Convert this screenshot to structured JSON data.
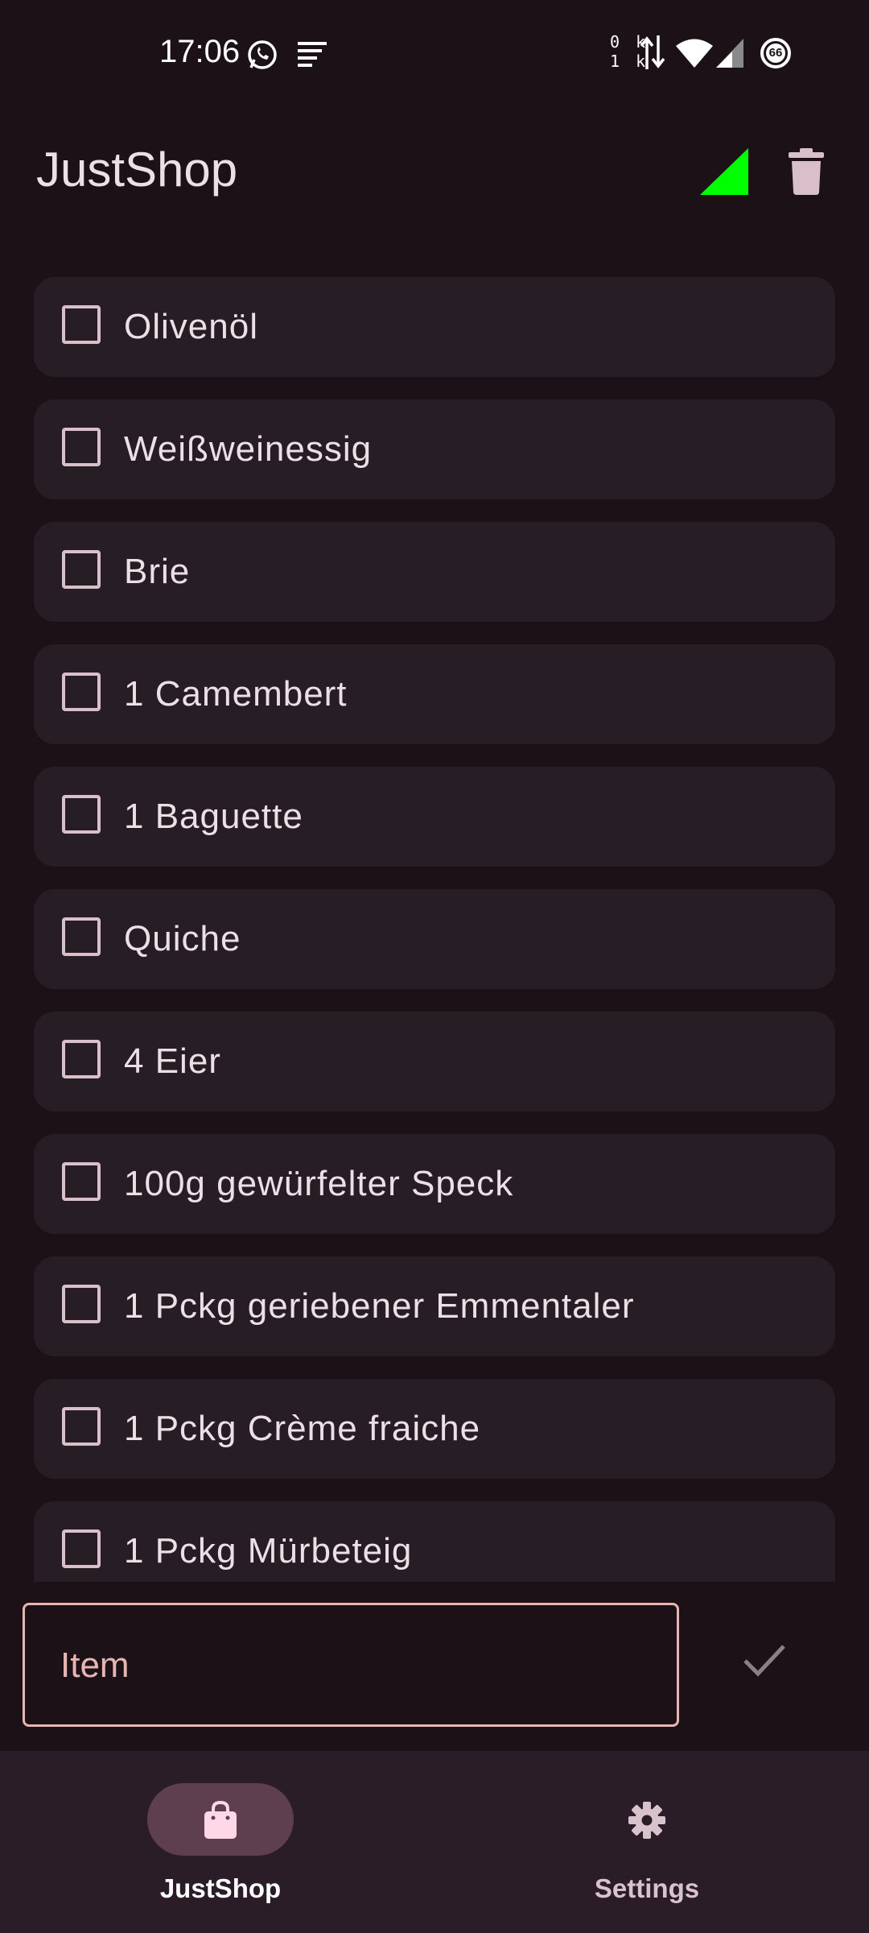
{
  "status_bar": {
    "time": "17:06",
    "net_up": "0 k",
    "net_down": "1 k",
    "battery": "66",
    "icons": [
      "whatsapp-icon",
      "notification-lines-icon",
      "data-arrows-icon",
      "wifi-icon",
      "cell-signal-icon",
      "battery-icon"
    ]
  },
  "app_bar": {
    "title": "JustShop",
    "actions": [
      "signal-triangle-icon",
      "trash-icon"
    ]
  },
  "list": {
    "items": [
      {
        "label": "Olivenöl",
        "checked": false
      },
      {
        "label": "Weißweinessig",
        "checked": false
      },
      {
        "label": "Brie",
        "checked": false
      },
      {
        "label": "1 Camembert",
        "checked": false
      },
      {
        "label": "1 Baguette",
        "checked": false
      },
      {
        "label": "Quiche",
        "checked": false
      },
      {
        "label": "4 Eier",
        "checked": false
      },
      {
        "label": "100g gewürfelter Speck",
        "checked": false
      },
      {
        "label": "1 Pckg geriebener Emmentaler",
        "checked": false
      },
      {
        "label": "1 Pckg Crème fraiche",
        "checked": false
      },
      {
        "label": "1 Pckg Mürbeteig",
        "checked": false
      }
    ]
  },
  "input": {
    "placeholder": "Item",
    "value": ""
  },
  "bottom_nav": {
    "items": [
      {
        "label": "JustShop",
        "icon": "shopping-bag-icon",
        "active": true
      },
      {
        "label": "Settings",
        "icon": "gear-icon",
        "active": false
      }
    ]
  },
  "colors": {
    "background": "#1b1117",
    "card": "#271d24",
    "accent": "#e8b5b3",
    "signal_green": "#00ff00",
    "nav_active_pill": "#5e3f4f"
  }
}
